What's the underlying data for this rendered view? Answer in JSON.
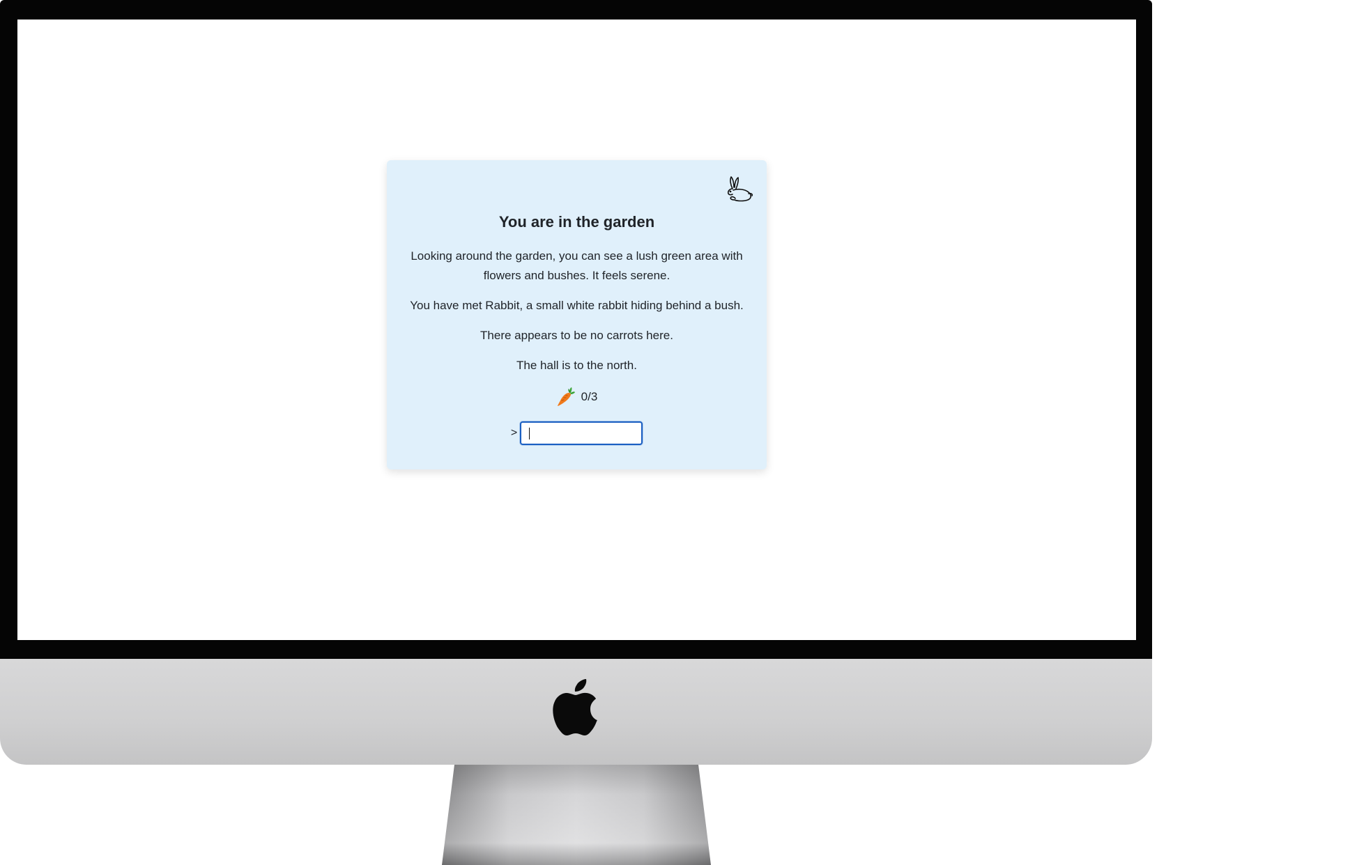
{
  "game": {
    "title": "You are in the garden",
    "paragraphs": [
      "Looking around the garden, you can see a lush green area with flowers and bushes. It feels serene.",
      "You have met Rabbit, a small white rabbit hiding behind a bush.",
      "There appears to be no carrots here.",
      "The hall is to the north."
    ],
    "carrot_count": "0/3",
    "prompt_symbol": ">",
    "command_input": {
      "value": "",
      "placeholder": ""
    },
    "icons": {
      "header": "rabbit-icon",
      "counter": "carrot-icon",
      "brand": "apple-logo-icon"
    }
  },
  "colors": {
    "card_background": "#e0f0fb",
    "input_border": "#1a5fc2",
    "carrot_orange": "#f07a1c",
    "carrot_leaf": "#3aa335"
  }
}
